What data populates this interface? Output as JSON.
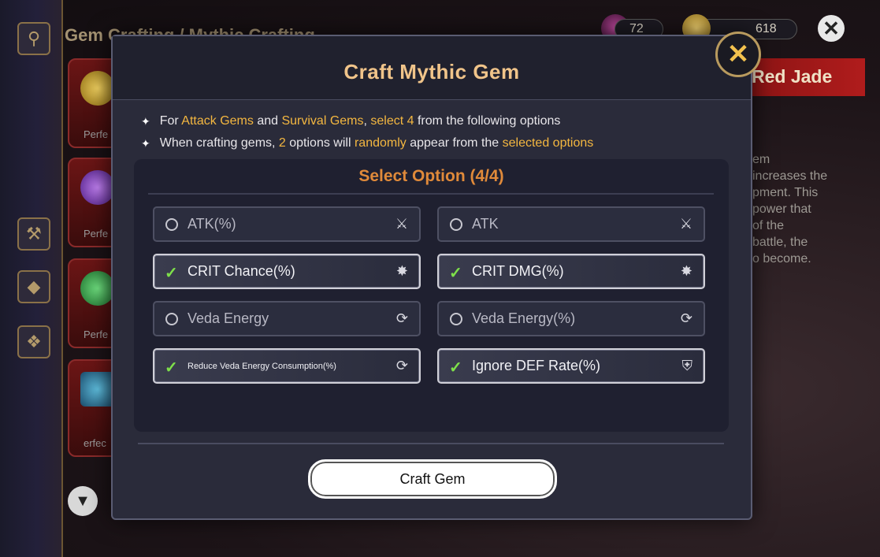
{
  "background": {
    "title": "Gem Crafting / Mythic Crafting",
    "currency_1_value": "72",
    "currency_2_value": "618",
    "banner_text": "Red Jade",
    "description_lines": [
      "em",
      "increases the",
      "pment. This",
      "power that",
      "of the",
      "battle, the",
      "o become."
    ],
    "gem_tiles": [
      {
        "label": "Perfe",
        "color": "#d4a628"
      },
      {
        "label": "Perfe",
        "color": "#8a3ad0"
      },
      {
        "label": "Perfe",
        "color": "#2fa040"
      },
      {
        "label": "erfec",
        "color": "#2a7aa0"
      }
    ]
  },
  "modal": {
    "title": "Craft Mythic Gem",
    "notes": {
      "line1": {
        "p1": "For ",
        "h1": "Attack Gems",
        "p2": " and ",
        "h2": "Survival Gems",
        "p3": ", ",
        "h3": "select 4",
        "p4": " from the following options"
      },
      "line2": {
        "p1": "When crafting gems, ",
        "h1": "2",
        "p2": " options will ",
        "h2": "randomly",
        "p3": " appear from the ",
        "h3": "selected options"
      }
    },
    "panel_title": "Select Option (4/4)",
    "options": [
      {
        "label": "ATK(%)",
        "selected": false,
        "icon": "sword-icon"
      },
      {
        "label": "ATK",
        "selected": false,
        "icon": "sword-icon"
      },
      {
        "label": "CRIT Chance(%)",
        "selected": true,
        "icon": "crit-burst-icon"
      },
      {
        "label": "CRIT DMG(%)",
        "selected": true,
        "icon": "crit-burst-icon"
      },
      {
        "label": "Veda Energy",
        "selected": false,
        "icon": "energy-swirl-icon"
      },
      {
        "label": "Veda Energy(%)",
        "selected": false,
        "icon": "energy-swirl-icon"
      },
      {
        "label": "Reduce Veda Energy Consumption(%)",
        "selected": true,
        "icon": "energy-swirl-icon"
      },
      {
        "label": "Ignore DEF Rate(%)",
        "selected": true,
        "icon": "broken-shield-icon"
      }
    ],
    "craft_button": "Craft Gem"
  },
  "colors": {
    "highlight": "#f4b740",
    "panel_title": "#e08a3a",
    "modal_title": "#f0c48a",
    "check": "#7ee04a"
  }
}
